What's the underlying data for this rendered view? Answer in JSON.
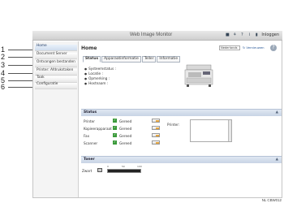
{
  "callouts": [
    "1",
    "2",
    "3",
    "4",
    "5",
    "6"
  ],
  "topbar": {
    "brand": "",
    "title": "Web Image Monitor",
    "tools": {
      "login": "Inloggen"
    }
  },
  "sidebar": {
    "items": [
      {
        "label": "Home"
      },
      {
        "label": "Document Server"
      },
      {
        "label": "Ontvangen bestanden"
      },
      {
        "label": "Printer: Afdrukstaken"
      },
      {
        "label": "Taak"
      },
      {
        "label": "Configuratie"
      }
    ]
  },
  "main": {
    "title": "Home",
    "language": "Nederlands",
    "refresh": "Vernieuwen",
    "tabs": [
      "Status",
      "Apparaatinformatie",
      "Teller",
      "Informatie"
    ],
    "status_lines": [
      "Systeemstatus",
      "Locatie",
      "Opmerking",
      "Hostnaam"
    ]
  },
  "status_section": {
    "title": "Status",
    "devices": [
      {
        "name": "Printer",
        "status": "Gereed"
      },
      {
        "name": "Kopieerapparaat",
        "status": "Gereed"
      },
      {
        "name": "Fax",
        "status": "Gereed"
      },
      {
        "name": "Scanner",
        "status": "Gereed"
      }
    ],
    "error_label": "Printer:"
  },
  "toner_section": {
    "title": "Toner",
    "item_label": "Zwart",
    "scale": [
      "0",
      "50",
      "100"
    ],
    "level_percent": 100
  },
  "footer_code": "NL CBW012"
}
